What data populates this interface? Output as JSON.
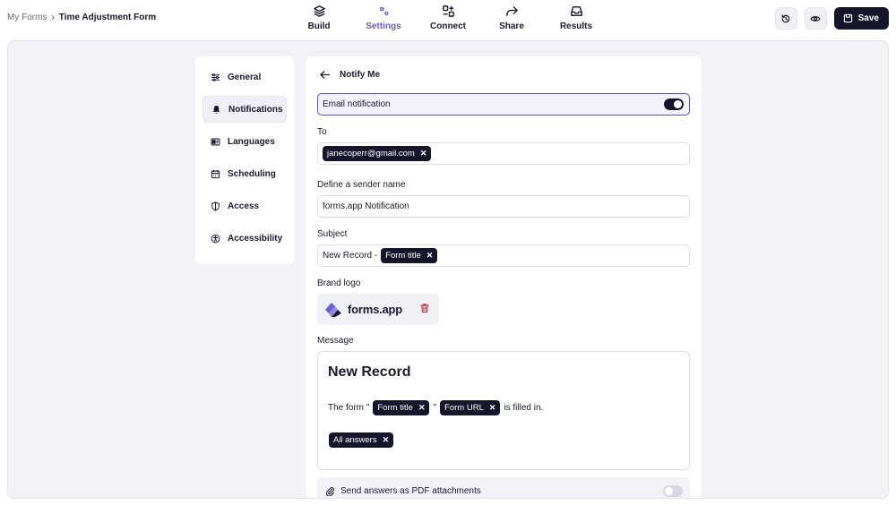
{
  "breadcrumb": {
    "root": "My Forms",
    "separator": "›",
    "current": "Time Adjustment Form"
  },
  "nav": {
    "build": "Build",
    "settings": "Settings",
    "connect": "Connect",
    "share": "Share",
    "results": "Results",
    "active": "Settings"
  },
  "actions": {
    "save_label": "Save"
  },
  "sidebar": {
    "items": [
      {
        "label": "General",
        "icon": "sliders-icon"
      },
      {
        "label": "Notifications",
        "icon": "bell-icon"
      },
      {
        "label": "Languages",
        "icon": "language-icon"
      },
      {
        "label": "Scheduling",
        "icon": "calendar-icon"
      },
      {
        "label": "Access",
        "icon": "shield-icon"
      },
      {
        "label": "Accessibility",
        "icon": "accessibility-icon"
      }
    ],
    "active": "Notifications"
  },
  "panel": {
    "title": "Notify Me",
    "email_notification_label": "Email notification",
    "email_notification_on": true,
    "to_label": "To",
    "to_chip": "janecoperr@gmail.com",
    "sender_label": "Define a sender name",
    "sender_value": "forms.app Notification",
    "subject_label": "Subject",
    "subject_prefix": "New Record -",
    "subject_chip": "Form title",
    "brand_logo_label": "Brand logo",
    "brand_logo_text": "forms.app",
    "message_label": "Message",
    "message_title": "New Record",
    "message_text_1": "The form \"",
    "message_chip_1": "Form title",
    "message_text_2": "\"",
    "message_chip_2": "Form URL",
    "message_text_3": "is filled in.",
    "message_chip_3": "All answers",
    "pdf_label": "Send answers as PDF attachments",
    "pdf_on": false
  },
  "colors": {
    "accent": "#6b5fce",
    "dark": "#15162b",
    "workspace_bg": "#f1f2f7"
  }
}
